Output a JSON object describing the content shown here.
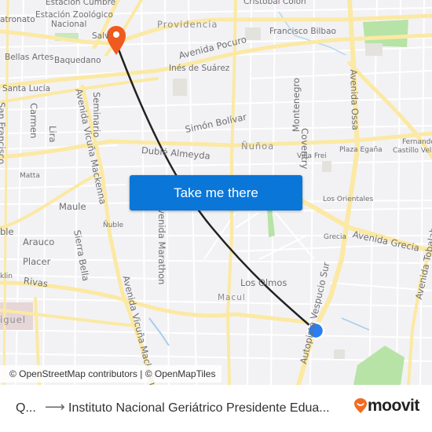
{
  "map": {
    "route": {
      "line_color": "#222222",
      "origin_marker_color": "#2a7ef0",
      "destination_marker_color": "#f05a1e"
    },
    "labels": {
      "cristobal_colon": "Cristóbal Colón",
      "estacion_cumbre": "Estación Cumbre",
      "estacion_zoologico_1": "Estación Zoológico",
      "estacion_zoologico_2": "Nacional",
      "patronato": "atronato",
      "providencia": "Providencia",
      "salvador": "Salv",
      "francisco_bilbao": "Francisco Bilbao",
      "bellas_artes": "Bellas Artes",
      "baquedano": "Baquedano",
      "avenida_pocuro": "Avenida Pocuro",
      "ines_de_suarez": "Inés de Suárez",
      "santa_lucia": "Santa Lucía",
      "san_francisco": "San Francisco",
      "carmen": "Carmen",
      "lira": "Lira",
      "vicuna_mackenna_1": "Avenida Vicuña Mackenna",
      "seminario": "Seminario",
      "montenegro": "Montenegro",
      "coventry": "Coventry",
      "avenida_ossa": "Avenida Ossa",
      "simon_bolivar": "Simón Bolívar",
      "nunoa": "Ñuñoa",
      "duble_almeyda": "Dublé Almeyda",
      "villa_frei": "Villa Frei",
      "plaza_egana": "Plaza Egaña",
      "fernando_1": "Fernando",
      "fernando_2": "Castillo Velas",
      "matta": "Matta",
      "maule": "Maule",
      "nuble_station": "Ñuble",
      "los_orientales": "Los Orientales",
      "nuble_left": "ble",
      "arauco": "Arauco",
      "sierra_bella": "Sierra Bella",
      "avenida_marathon": "Avenida Marathon",
      "grecia": "Grecia",
      "avenida_grecia": "Avenida Grecia",
      "placer": "Placer",
      "franklin": "klin",
      "rivas": "Rivas",
      "vicuna_mackenna_2": "Avenida Vicuña Mackenna",
      "avenida_tobalaba": "Avenida Tobalaba",
      "los_olmos": "Los Olmos",
      "macul": "Macul",
      "americo_vespucio": "Autopista Vespucio Sur",
      "san_miguel": "iguel",
      "vicuna_fragment": "s"
    },
    "cta_label": "Take me there",
    "attribution": "© OpenStreetMap contributors | © OpenMapTiles"
  },
  "footer": {
    "origin": "Q...",
    "arrow": "⟶",
    "destination": "Instituto Nacional Geriátrico Presidente Edua...",
    "brand": "moovit",
    "brand_color": "#f26a21"
  }
}
